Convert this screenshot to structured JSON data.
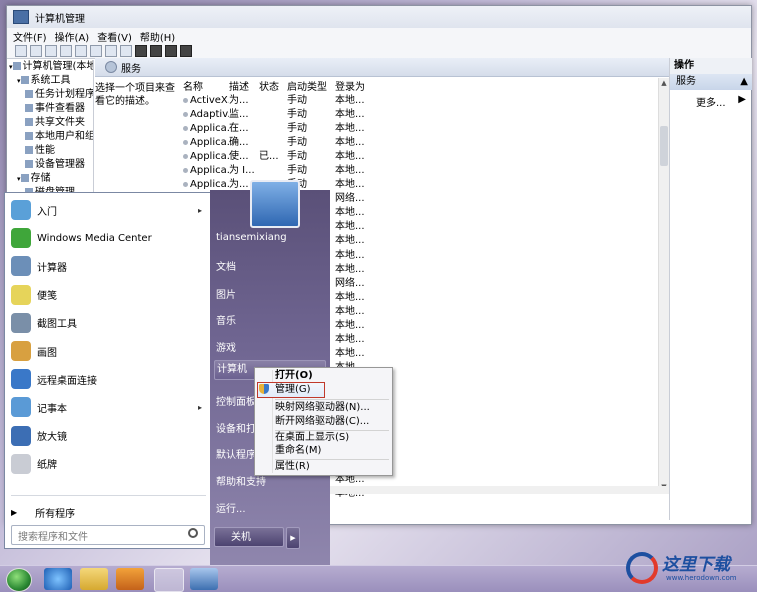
{
  "window": {
    "title": "计算机管理",
    "menu": [
      "文件(F)",
      "操作(A)",
      "查看(V)",
      "帮助(H)"
    ]
  },
  "tree": {
    "items": [
      {
        "label": "计算机管理(本地)",
        "indent": 0
      },
      {
        "label": "系统工具",
        "indent": 1
      },
      {
        "label": "任务计划程序",
        "indent": 2
      },
      {
        "label": "事件查看器",
        "indent": 2
      },
      {
        "label": "共享文件夹",
        "indent": 2
      },
      {
        "label": "本地用户和组",
        "indent": 2
      },
      {
        "label": "性能",
        "indent": 2
      },
      {
        "label": "设备管理器",
        "indent": 2
      },
      {
        "label": "存储",
        "indent": 1
      },
      {
        "label": "磁盘管理",
        "indent": 2
      }
    ]
  },
  "services": {
    "header": "服务",
    "description": "选择一个项目来查看它的描述。",
    "columns": {
      "name": "名称",
      "desc": "描述",
      "status": "状态",
      "startup": "启动类型",
      "logon": "登录为"
    },
    "rows": [
      {
        "name": "ActiveX...",
        "desc": "为...",
        "status": "",
        "startup": "手动",
        "logon": "本地..."
      },
      {
        "name": "Adaptiv...",
        "desc": "监...",
        "status": "",
        "startup": "手动",
        "logon": "本地..."
      },
      {
        "name": "Applica...",
        "desc": "在...",
        "status": "",
        "startup": "手动",
        "logon": "本地..."
      },
      {
        "name": "Applica...",
        "desc": "确...",
        "status": "",
        "startup": "手动",
        "logon": "本地..."
      },
      {
        "name": "Applica...",
        "desc": "使...",
        "status": "已...",
        "startup": "手动",
        "logon": "本地..."
      },
      {
        "name": "Applica...",
        "desc": "为 I...",
        "status": "",
        "startup": "手动",
        "logon": "本地..."
      },
      {
        "name": "Applica...",
        "desc": "为...",
        "status": "",
        "startup": "手动",
        "logon": "本地..."
      },
      {
        "name": "",
        "desc": "",
        "status": "",
        "startup": "",
        "logon": "网络..."
      },
      {
        "name": "",
        "desc": "",
        "status": "",
        "startup": "",
        "logon": "本地..."
      },
      {
        "name": "",
        "desc": "",
        "status": "",
        "startup": "",
        "logon": "本地..."
      },
      {
        "name": "",
        "desc": "",
        "status": "",
        "startup": "",
        "logon": "本地..."
      },
      {
        "name": "",
        "desc": "",
        "status": "",
        "startup": "",
        "logon": "本地..."
      },
      {
        "name": "",
        "desc": "",
        "status": "",
        "startup": "",
        "logon": "本地..."
      },
      {
        "name": "",
        "desc": "",
        "status": "",
        "startup": "",
        "logon": "网络..."
      },
      {
        "name": "",
        "desc": "",
        "status": "",
        "startup": "",
        "logon": "本地..."
      },
      {
        "name": "",
        "desc": "",
        "status": "",
        "startup": "",
        "logon": "本地..."
      },
      {
        "name": "",
        "desc": "",
        "status": "",
        "startup": "",
        "logon": "本地..."
      },
      {
        "name": "",
        "desc": "",
        "status": "",
        "startup": "",
        "logon": "本地..."
      },
      {
        "name": "",
        "desc": "",
        "status": "",
        "startup": "",
        "logon": "本地..."
      },
      {
        "name": "",
        "desc": "",
        "status": "",
        "startup": "",
        "logon": "本地..."
      },
      {
        "name": "",
        "desc": "",
        "status": "",
        "startup": "",
        "logon": "本地..."
      },
      {
        "name": "",
        "desc": "",
        "status": "",
        "startup": "",
        "logon": "本地..."
      },
      {
        "name": "",
        "desc": "",
        "status": "",
        "startup": "",
        "logon": "本地..."
      },
      {
        "name": "",
        "desc": "",
        "status": "",
        "startup": "",
        "logon": "本地..."
      },
      {
        "name": "",
        "desc": "",
        "status": "",
        "startup": "",
        "logon": "本地..."
      },
      {
        "name": "",
        "desc": "",
        "status": "",
        "startup": "",
        "logon": "本地..."
      },
      {
        "name": "",
        "desc": "",
        "status": "",
        "startup": "",
        "logon": "本地..."
      },
      {
        "name": "",
        "desc": "",
        "status": "",
        "startup": "",
        "logon": "本地..."
      },
      {
        "name": "",
        "desc": "",
        "status": "",
        "startup": "",
        "logon": "本地..."
      }
    ]
  },
  "actions": {
    "title": "操作",
    "section": "服务",
    "more": "更多..."
  },
  "start_menu": {
    "programs": [
      {
        "label": "入门",
        "icon": "getting-started-icon",
        "color": "#5aa0d8",
        "submenu": true
      },
      {
        "label": "Windows Media Center",
        "icon": "media-center-icon",
        "color": "#3fa63a",
        "submenu": false
      },
      {
        "label": "计算器",
        "icon": "calculator-icon",
        "color": "#6c8fb8",
        "submenu": false
      },
      {
        "label": "便笺",
        "icon": "sticky-notes-icon",
        "color": "#e6d45a",
        "submenu": false
      },
      {
        "label": "截图工具",
        "icon": "scissors-icon",
        "color": "#7a8fa8",
        "submenu": false
      },
      {
        "label": "画图",
        "icon": "paint-icon",
        "color": "#d8a040",
        "submenu": false
      },
      {
        "label": "远程桌面连接",
        "icon": "remote-desktop-icon",
        "color": "#3a78c8",
        "submenu": false
      },
      {
        "label": "记事本",
        "icon": "notepad-icon",
        "color": "#5a9ad6",
        "submenu": true
      },
      {
        "label": "放大镜",
        "icon": "magnifier-icon",
        "color": "#3c6eb4",
        "submenu": false
      },
      {
        "label": "纸牌",
        "icon": "solitaire-icon",
        "color": "#c9ccd4",
        "submenu": false
      }
    ],
    "all_programs": "所有程序",
    "search_placeholder": "搜索程序和文件",
    "right_items": [
      "tiansemixiang",
      "文档",
      "图片",
      "音乐",
      "游戏",
      "计算机",
      "控制面板",
      "设备和打印机",
      "默认程序",
      "帮助和支持",
      "运行..."
    ],
    "selected_right": "计算机",
    "shutdown": "关机"
  },
  "context_menu": {
    "items": [
      "打开(O)",
      "管理(G)",
      "映射网络驱动器(N)...",
      "断开网络驱动器(C)...",
      "在桌面上显示(S)",
      "重命名(M)",
      "属性(R)"
    ],
    "highlighted": "管理(G)"
  },
  "watermark": {
    "text": "这里下载",
    "url": "www.herodown.com"
  }
}
